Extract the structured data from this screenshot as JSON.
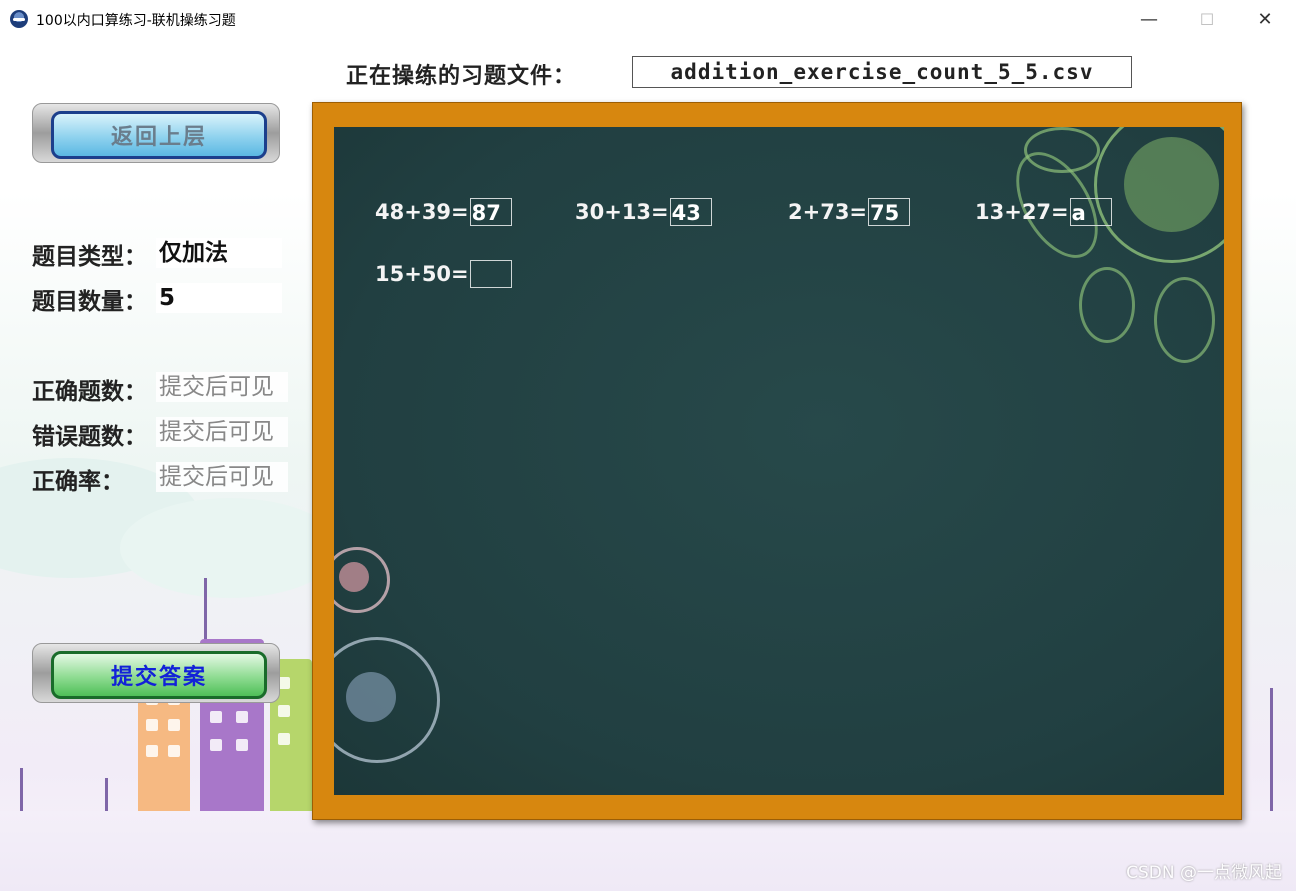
{
  "window": {
    "title": "100以内口算练习-联机操练习题",
    "minimize": "—",
    "maximize": "☐",
    "close": "✕"
  },
  "file": {
    "label": "正在操练的习题文件：",
    "name": "addition_exercise_count_5_5.csv"
  },
  "buttons": {
    "back": "返回上层",
    "submit": "提交答案"
  },
  "info": {
    "type_label": "题目类型：",
    "type_value": "仅加法",
    "count_label": "题目数量：",
    "count_value": "5",
    "correct_label": "正确题数：",
    "correct_value": "提交后可见",
    "wrong_label": "错误题数：",
    "wrong_value": "提交后可见",
    "rate_label": "正确率：",
    "rate_value": "提交后可见"
  },
  "problems": [
    {
      "expr": "48+39=",
      "answer": "87"
    },
    {
      "expr": "30+13=",
      "answer": "43"
    },
    {
      "expr": "2+73=",
      "answer": "75"
    },
    {
      "expr": "13+27=",
      "answer": "a"
    },
    {
      "expr": "15+50=",
      "answer": ""
    }
  ],
  "watermark": "CSDN @一点微风起",
  "colors": {
    "board": "#213f41",
    "frame": "#d7870f",
    "submit_text": "#1221d8"
  }
}
